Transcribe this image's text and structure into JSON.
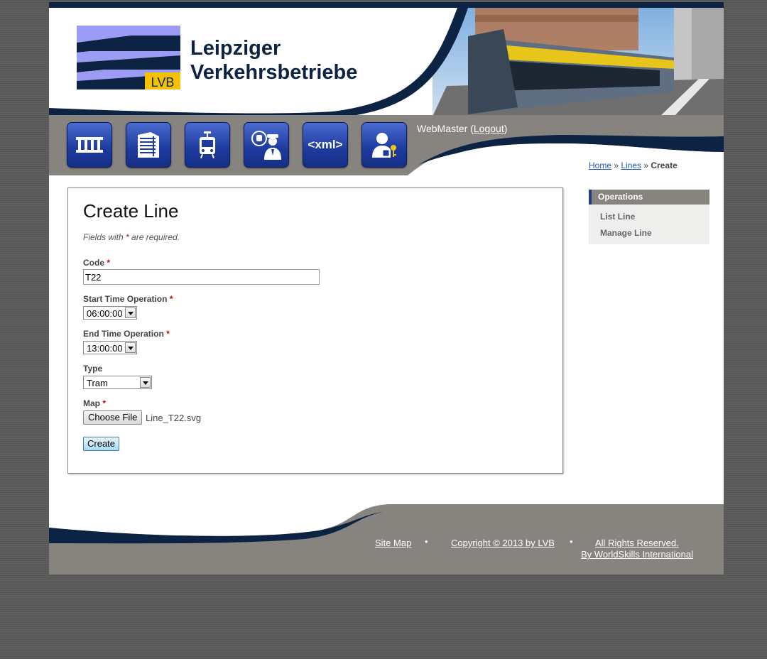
{
  "header": {
    "logo_text": "LVB",
    "brand_line1": "Leipziger",
    "brand_line2": "Verkehrsbetriebe"
  },
  "nav": {
    "buttons": [
      {
        "icon": "stops-icon"
      },
      {
        "icon": "building-icon"
      },
      {
        "icon": "tram-icon"
      },
      {
        "icon": "driver-icon"
      },
      {
        "icon": "xml-icon",
        "label": "<xml>"
      },
      {
        "icon": "user-keys-icon"
      }
    ],
    "user_name": "WebMaster",
    "logout_label": "Logout",
    "paren_open": " (",
    "paren_close": ")"
  },
  "breadcrumb": {
    "home": "Home",
    "sep": " » ",
    "lines": "Lines",
    "current": "Create"
  },
  "form": {
    "title": "Create Line",
    "note_prefix": "Fields with ",
    "note_star": "*",
    "note_suffix": " are required.",
    "required_mark": "*",
    "code_label": "Code",
    "code_value": "T22",
    "start_label": "Start Time Operation",
    "start_value": "06:00:00",
    "end_label": "End Time Operation",
    "end_value": "13:00:00",
    "type_label": "Type",
    "type_value": "Tram",
    "map_label": "Map",
    "choose_file_label": "Choose File",
    "file_name": "Line_T22.svg",
    "submit_label": "Create"
  },
  "sidebar": {
    "title": "Operations",
    "items": [
      "List Line",
      "Manage Line"
    ]
  },
  "footer": {
    "site_map": "Site Map",
    "bullet": "•",
    "copyright": "Copyright © 2013 by LVB",
    "rights_line1": "All Rights Reserved.",
    "rights_line2": "By WorldSkills International"
  },
  "colors": {
    "navy": "#0d2344",
    "gray_band": "#878480",
    "button_blue": "#1d3a9e",
    "logo_stripe": "#9d9cf5",
    "logo_yellow": "#f4c200",
    "link_blue": "#1c56b5"
  }
}
